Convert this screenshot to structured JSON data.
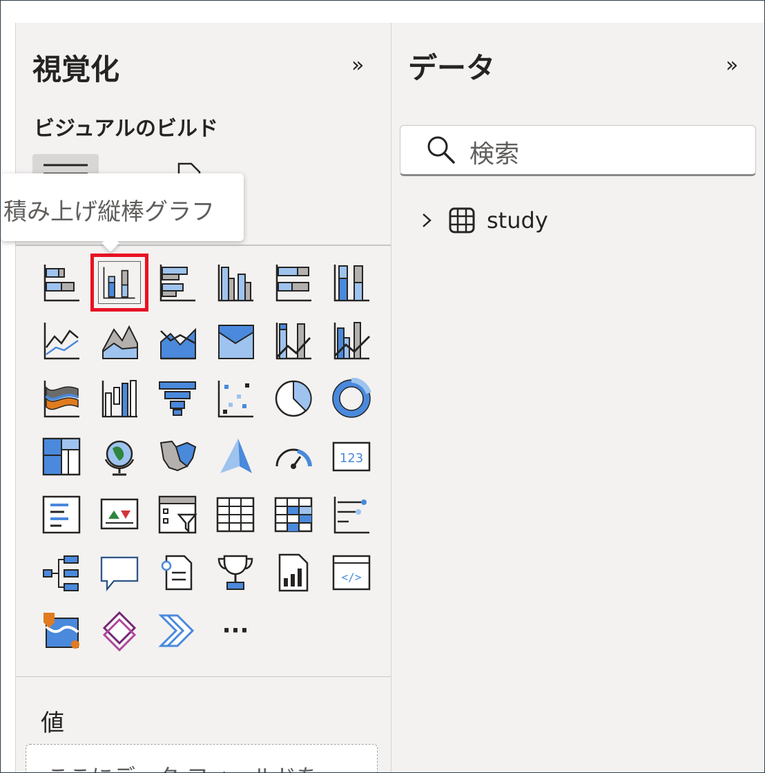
{
  "visualizations": {
    "title": "視覚化",
    "collapse_icon": "double-chevron-right-icon",
    "build_title": "ビジュアルのビルド",
    "tooltip": "積み上げ縦棒グラフ",
    "values_label": "値",
    "values_placeholder": "ここにデータ フィールドを",
    "visuals": [
      {
        "name": "stacked-bar-chart-icon"
      },
      {
        "name": "stacked-column-chart-icon",
        "selected": true
      },
      {
        "name": "clustered-bar-chart-icon"
      },
      {
        "name": "clustered-column-chart-icon"
      },
      {
        "name": "100-stacked-bar-chart-icon"
      },
      {
        "name": "100-stacked-column-chart-icon"
      },
      {
        "name": "line-chart-icon"
      },
      {
        "name": "area-chart-icon"
      },
      {
        "name": "stacked-area-chart-icon"
      },
      {
        "name": "100-stacked-area-chart-icon"
      },
      {
        "name": "line-and-stacked-column-chart-icon"
      },
      {
        "name": "line-and-clustered-column-chart-icon"
      },
      {
        "name": "ribbon-chart-icon"
      },
      {
        "name": "waterfall-chart-icon"
      },
      {
        "name": "funnel-chart-icon"
      },
      {
        "name": "scatter-chart-icon"
      },
      {
        "name": "pie-chart-icon"
      },
      {
        "name": "donut-chart-icon"
      },
      {
        "name": "treemap-icon"
      },
      {
        "name": "map-icon"
      },
      {
        "name": "filled-map-icon"
      },
      {
        "name": "azure-map-icon"
      },
      {
        "name": "gauge-icon"
      },
      {
        "name": "card-icon",
        "text": "123"
      },
      {
        "name": "multi-row-card-icon"
      },
      {
        "name": "kpi-icon"
      },
      {
        "name": "slicer-icon"
      },
      {
        "name": "table-icon"
      },
      {
        "name": "matrix-icon"
      },
      {
        "name": "key-influencers-icon"
      },
      {
        "name": "decomposition-tree-icon"
      },
      {
        "name": "qna-icon"
      },
      {
        "name": "smart-narrative-icon"
      },
      {
        "name": "metrics-icon"
      },
      {
        "name": "paginated-report-icon"
      },
      {
        "name": "html-content-icon"
      },
      {
        "name": "arcgis-map-icon"
      },
      {
        "name": "power-apps-icon"
      },
      {
        "name": "power-automate-icon"
      },
      {
        "name": "more-visuals-icon",
        "text": "···"
      }
    ]
  },
  "data": {
    "title": "データ",
    "collapse_icon": "double-chevron-right-icon",
    "search_placeholder": "検索",
    "tables": [
      {
        "label": "study",
        "icon": "table-icon",
        "expand_icon": "chevron-right-icon"
      }
    ]
  },
  "colors": {
    "accent_blue": "#4a89dc",
    "fill_blue": "#9ec3ee",
    "gray": "#b3b0ad",
    "dark": "#252423",
    "selection_red": "#e81123",
    "panel_bg": "#f3f2f1"
  }
}
